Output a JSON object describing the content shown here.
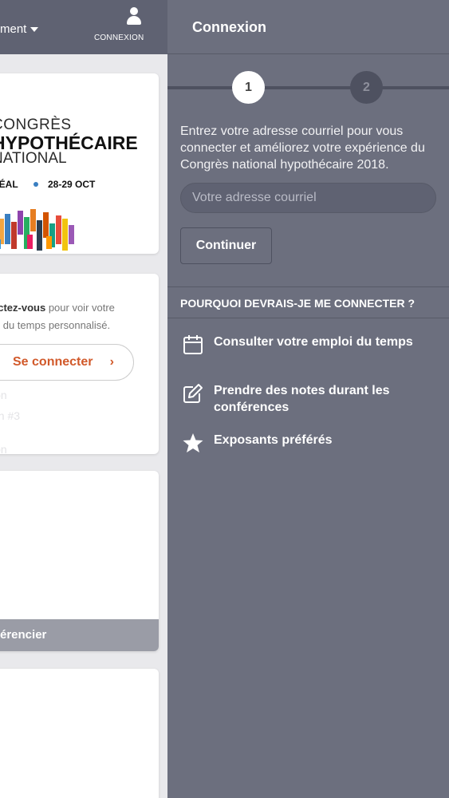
{
  "left_panel": {
    "menu_label": "ment",
    "user_label": "CONNEXION",
    "logo": {
      "line1": "CONGRÈS",
      "line2": "HYPOTHÉCAIRE",
      "line3": "NATIONAL",
      "place": "RÉAL",
      "date": "28-29 OCT"
    },
    "promo": {
      "bold": "ectez-vous",
      "rest1": " pour voir votre",
      "line2": "oi du temps personnalisé."
    },
    "login_button": "Se connecter",
    "login_chevron": "›",
    "faded_1": "ion",
    "faded_2": "on #3",
    "faded_3": "ion",
    "grey_bar": "érencier"
  },
  "panel": {
    "title": "Connexion",
    "step1": "1",
    "step2": "2",
    "intro": "Entrez votre adresse courriel pour vous connecter et améliorez votre expérience du Congrès national hypothécaire 2018.",
    "email_placeholder": "Votre adresse courriel",
    "continue_label": "Continuer",
    "why_heading": "POURQUOI DEVRAIS-JE ME CONNECTER ?",
    "reasons": [
      {
        "icon": "calendar-icon",
        "label": "Consulter votre emploi du temps"
      },
      {
        "icon": "edit-note-icon",
        "label": "Prendre des notes durant les conférences"
      },
      {
        "icon": "star-icon",
        "label": "Exposants préférés"
      }
    ]
  },
  "colors": {
    "panel_bg": "#6c6f7e",
    "header_bg": "#5f6272",
    "accent_orange": "#d1592a"
  }
}
